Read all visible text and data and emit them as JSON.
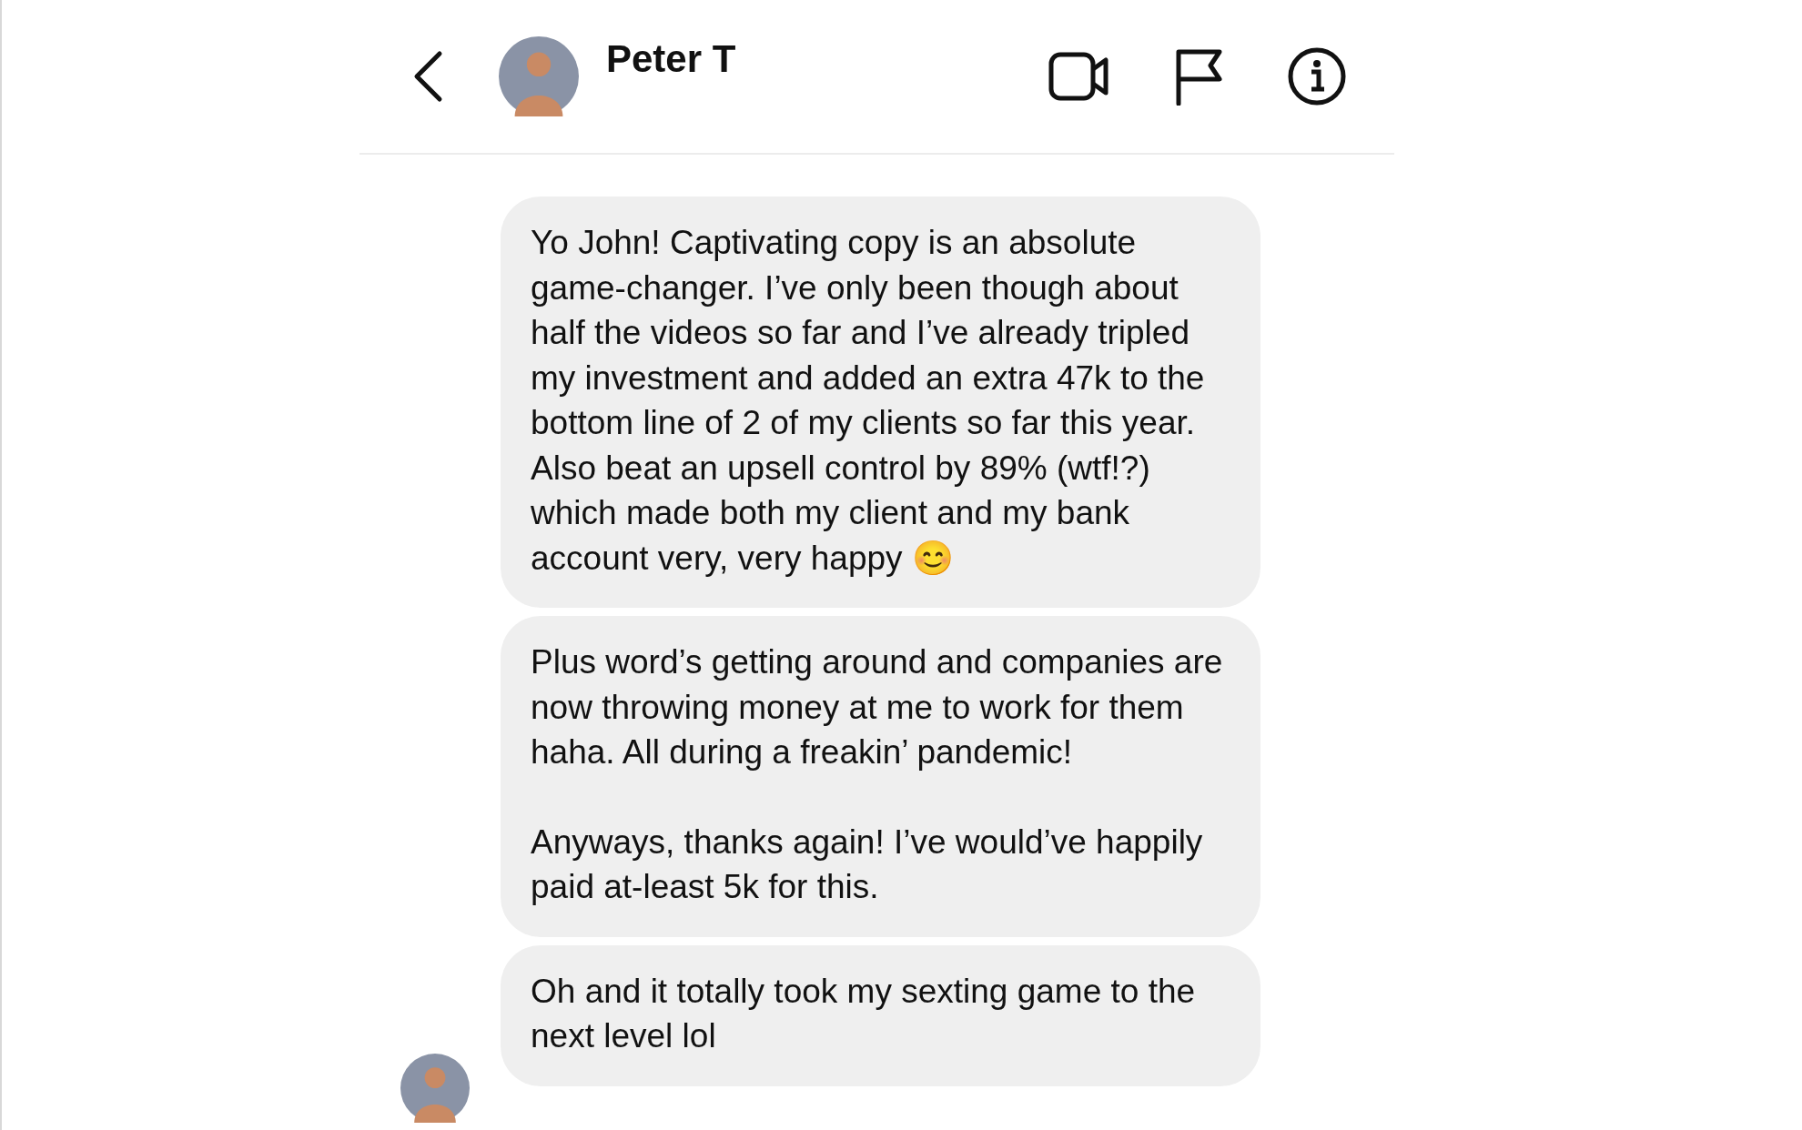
{
  "header": {
    "name": "Peter T"
  },
  "messages": [
    {
      "paragraphs": [
        "Yo John! Captivating copy is an absolute game-changer. I’ve only been though about half the videos so far and I’ve already tripled my investment and added an extra 47k to the bottom line of 2 of my clients so far this year. Also beat an upsell control by 89% (wtf!?) which made both my client and my bank account very, very happy 😊"
      ],
      "avatar": false
    },
    {
      "paragraphs": [
        "Plus word’s getting around and companies are now throwing money at me to work for them haha. All during a freakin’ pandemic!",
        "Anyways, thanks again! I’ve would’ve happily paid at-least 5k for this."
      ],
      "avatar": false
    },
    {
      "paragraphs": [
        "Oh and it totally took my sexting game to the next level lol"
      ],
      "avatar": true
    }
  ]
}
